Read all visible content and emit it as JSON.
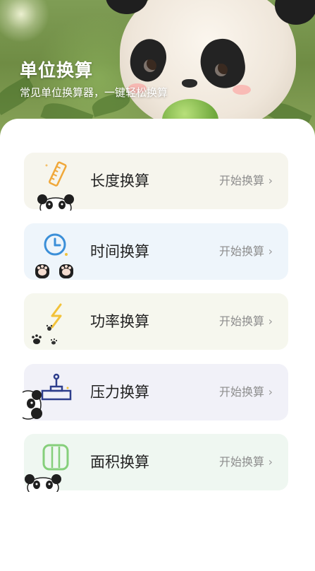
{
  "header": {
    "title": "单位换算",
    "subtitle": "常见单位换算器，一键轻松换算"
  },
  "colors": {
    "length_card": "#f6f5ed",
    "time_card": "#eef5fb",
    "power_card": "#f6f7ee",
    "pressure_card": "#f1f1f8",
    "area_card": "#eff7f1",
    "ruler_icon": "#f0a83a",
    "clock_icon": "#3b8fd8",
    "bolt_icon": "#f2c23a",
    "gauge_icon": "#2e3e8c",
    "area_icon": "#86cf7b"
  },
  "menu": [
    {
      "label": "长度换算",
      "action": "开始换算",
      "icon": "ruler-icon"
    },
    {
      "label": "时间换算",
      "action": "开始换算",
      "icon": "clock-icon"
    },
    {
      "label": "功率换算",
      "action": "开始换算",
      "icon": "lightning-icon"
    },
    {
      "label": "压力换算",
      "action": "开始换算",
      "icon": "pressure-gauge-icon"
    },
    {
      "label": "面积换算",
      "action": "开始换算",
      "icon": "area-icon"
    }
  ],
  "chevron": "›"
}
